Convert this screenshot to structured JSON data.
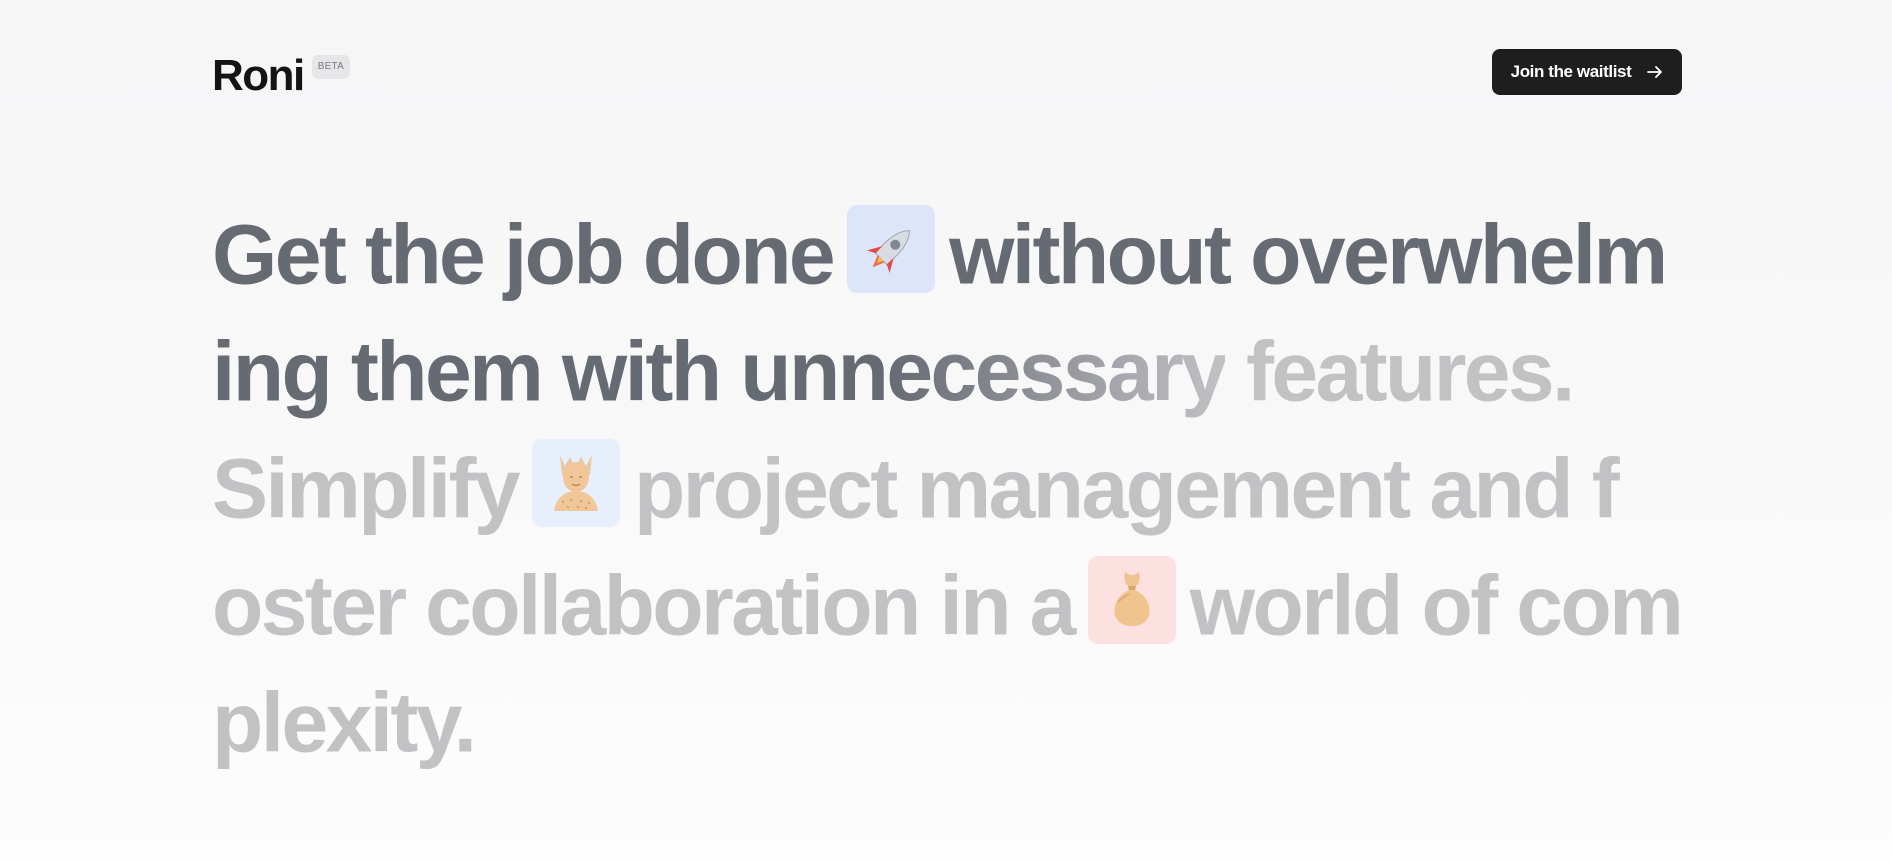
{
  "header": {
    "logo_text": "Roni",
    "beta_label": "BETA",
    "cta_label": "Join the waitlist",
    "cta_icon": "arrow-right-icon"
  },
  "hero": {
    "l1_a": "Get the job done",
    "l1_b": "without overwhelm",
    "l2_a": "ing them with ",
    "l2_b": "unnecessary",
    "l2_c": " features.",
    "l3_a": "Simplify",
    "l3_b": "project management and f",
    "l4_a": "oster collaboration in a",
    "l4_b": "world of com",
    "l5_a": "plexity.",
    "icons": [
      "rocket-icon",
      "person-icon",
      "money-bag-icon"
    ]
  },
  "colors": {
    "primary_text": "#666a73",
    "faded_text": "#c2c2c5",
    "cta_background": "#1e1e1f",
    "rocket_tile": "#dde5fb",
    "person_tile": "#e7eefc",
    "bag_tile": "#fde1e1"
  }
}
